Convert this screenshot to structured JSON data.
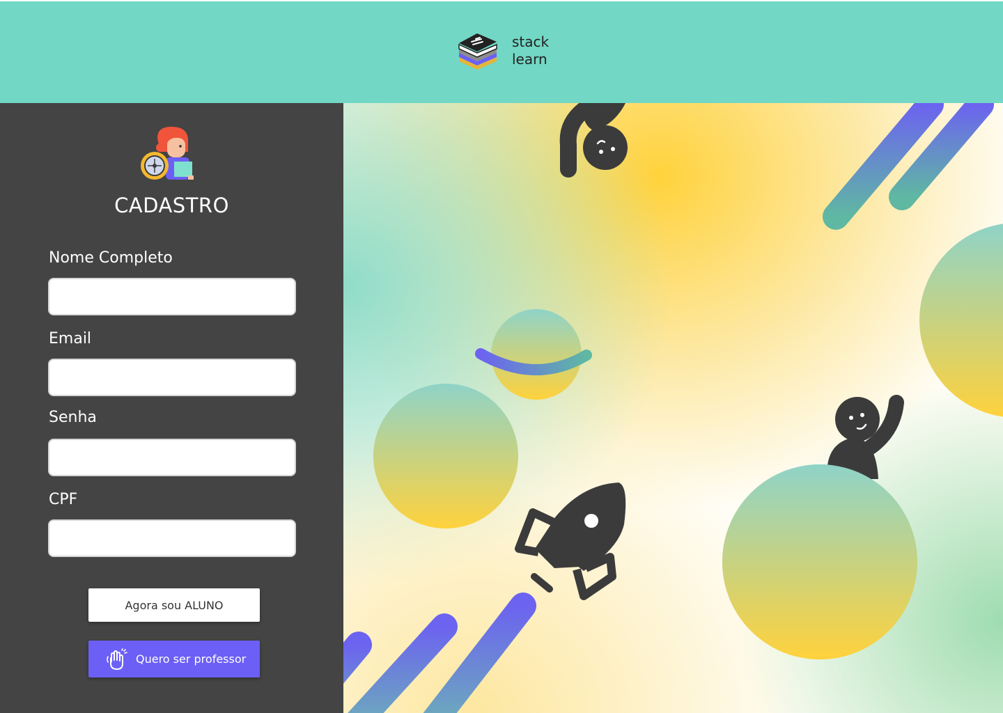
{
  "header": {
    "logo_icon": "stacked-books-icon",
    "logo_line1": "stack",
    "logo_line2": "learn",
    "background": "#72d7c5"
  },
  "form": {
    "avatar_icon": "teacher-avatar-icon",
    "title": "CADASTRO",
    "fields": [
      {
        "label": "Nome Completo",
        "value": "",
        "placeholder": ""
      },
      {
        "label": "Email",
        "value": "",
        "placeholder": ""
      },
      {
        "label": "Senha",
        "value": "",
        "placeholder": ""
      },
      {
        "label": "CPF",
        "value": "",
        "placeholder": ""
      }
    ],
    "student_button": "Agora sou ALUNO",
    "teacher_button": "Quero ser professor",
    "teacher_button_icon": "waving-hand-icon",
    "panel_color": "#444444",
    "accent_color": "#6c5ff5"
  },
  "illustration": {
    "elements": [
      "hanging-figure-icon",
      "planet-icon",
      "rocket-icon",
      "waving-figure-icon"
    ],
    "colors": {
      "teal": "#8fd3c8",
      "yellow": "#ffd23c",
      "purple": "#6c63f0",
      "dark": "#3b3b3b"
    }
  }
}
